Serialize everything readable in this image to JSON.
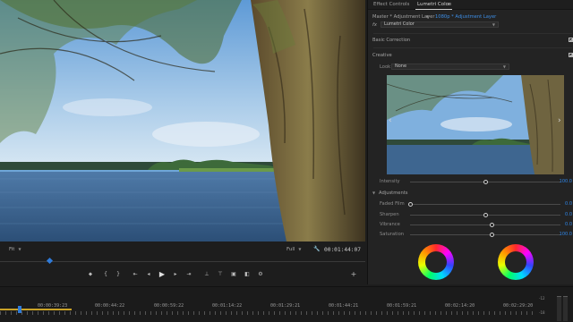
{
  "monitor": {
    "fit_label": "Fit",
    "quality_label": "Full",
    "timecode": "00:01:44:07",
    "playhead_fraction": 0.13,
    "controls": [
      "marker-icon",
      "in-point-icon",
      "out-point-icon",
      "go-to-in-icon",
      "step-back-icon",
      "play-icon",
      "step-forward-icon",
      "go-to-out-icon",
      "lift-icon",
      "extract-icon",
      "export-frame-icon",
      "comparison-view-icon",
      "settings-icon",
      "add-icon"
    ]
  },
  "panel": {
    "tabs": {
      "effect_controls": "Effect Controls",
      "lumetri_color": "Lumetri Color",
      "menu": "≡"
    },
    "source": {
      "master": "Master * Adjustment Layer",
      "target": "1080p * Adjustment Layer"
    },
    "effect": {
      "fx": "fx",
      "name": "Lumetri Color"
    },
    "basic_correction": "Basic Correction",
    "creative": "Creative",
    "look": {
      "label": "Look",
      "value": "None"
    },
    "intensity": {
      "label": "Intensity",
      "value": "100.0",
      "fraction": 0.5
    },
    "adjustments": {
      "label": "Adjustments",
      "items": [
        {
          "label": "Faded Film",
          "value": "0.0",
          "fraction": 0.0
        },
        {
          "label": "Sharpen",
          "value": "0.0",
          "fraction": 0.5
        },
        {
          "label": "Vibrance",
          "value": "0.0",
          "fraction": 0.54
        },
        {
          "label": "Saturation",
          "value": "100.0",
          "fraction": 0.54
        }
      ]
    }
  },
  "timeline": {
    "timecodes": [
      "00:00:39:23",
      "00:00:44:22",
      "00:00:59:22",
      "00:01:14:22",
      "00:01:29:21",
      "00:01:44:21",
      "00:01:59:21",
      "00:02:14:20",
      "00:02:29:20"
    ],
    "meter_labels": [
      "-12",
      "-18"
    ]
  },
  "colors": {
    "accent_blue": "#2f86e8",
    "work_area": "#c9a227",
    "panel_bg": "#232323"
  }
}
